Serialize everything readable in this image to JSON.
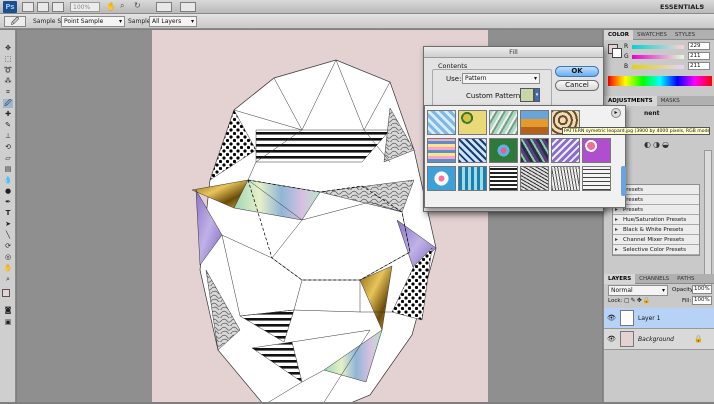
{
  "app": {
    "logo": "Ps",
    "zoom": "100%",
    "workspace": "ESSENTIALS"
  },
  "options_bar": {
    "sample_size_label": "Sample Size:",
    "sample_size_value": "Point Sample",
    "sample_label": "Sample:",
    "sample_value": "All Layers"
  },
  "fill_dialog": {
    "title": "Fill",
    "contents_label": "Contents",
    "use_label": "Use:",
    "use_value": "Pattern",
    "custom_pattern_label": "Custom Pattern:",
    "ok_label": "OK",
    "cancel_label": "Cancel"
  },
  "pattern_tooltip": "PATTERN symetric leopard.jpg (3900 by 4000 pixels, RGB mode)",
  "color_panel": {
    "tabs": [
      "COLOR",
      "SWATCHES",
      "STYLES"
    ],
    "channels": [
      {
        "label": "R",
        "value": "229"
      },
      {
        "label": "G",
        "value": "211"
      },
      {
        "label": "B",
        "value": "211"
      }
    ]
  },
  "adjustments_panel": {
    "tabs": [
      "ADJUSTMENTS",
      "MASKS"
    ],
    "heading": "nent",
    "presets": [
      "Presets",
      "Presets",
      "Presets",
      "Hue/Saturation Presets",
      "Black & White Presets",
      "Channel Mixer Presets",
      "Selective Color Presets"
    ]
  },
  "layers_panel": {
    "tabs": [
      "LAYERS",
      "CHANNELS",
      "PATHS"
    ],
    "blend_mode": "Normal",
    "opacity_label": "Opacity:",
    "opacity_value": "100%",
    "lock_label": "Lock:",
    "fill_label": "Fill:",
    "fill_value": "100%",
    "layers": [
      {
        "name": "Layer 1",
        "selected": true
      },
      {
        "name": "Background",
        "selected": false
      }
    ]
  },
  "colors": {
    "document_bg": "#e4d1d2",
    "selection_blue": "#b6d2f6",
    "ps_blue": "#1b4f8e"
  }
}
